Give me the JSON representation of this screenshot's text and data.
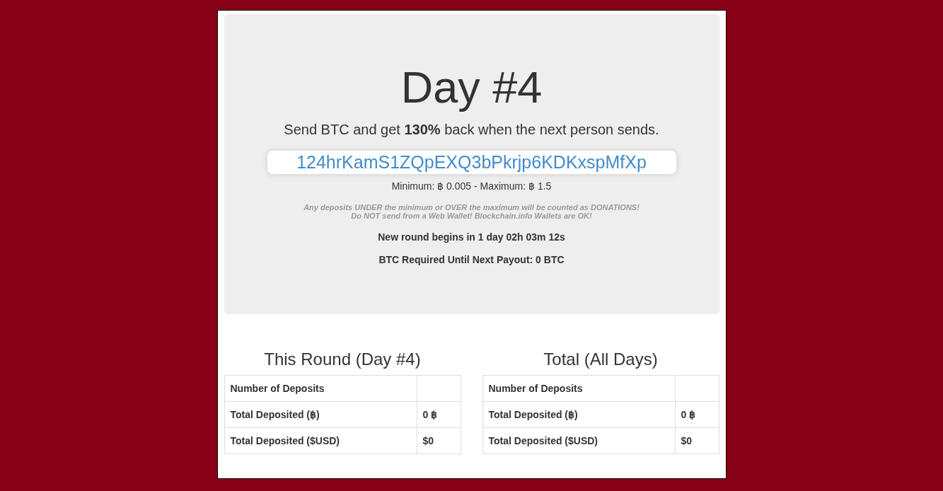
{
  "hero": {
    "title": "Day #4",
    "tagline": "Send BTC and get **130%** back when the next person sends.",
    "address": "124hrKamS1ZQpEXQ3bPkrjp6KDKxspMfXp",
    "limits": "Minimum: ฿ 0.005 - Maximum: ฿ 1.5",
    "warnings": [
      "Any deposits UNDER the minimum or OVER the maximum will be counted as DONATIONS!",
      "Do NOT send from a Web Wallet! Blockchain.info Wallets are OK!"
    ],
    "countdown": "New round begins in 1 day 02h 03m 12s",
    "required": "BTC Required Until Next Payout: 0 BTC"
  },
  "stats": [
    {
      "heading": "This Round (Day #4)",
      "rows": [
        {
          "label": "Number of Deposits"
        },
        {
          "label": "Total Deposited (฿)",
          "value": "0 ฿"
        },
        {
          "label": "Total Deposited ($USD)",
          "value": "$0"
        }
      ]
    },
    {
      "heading": "Total (All Days)",
      "rows": [
        {
          "label": "Number of Deposits"
        },
        {
          "label": "Total Deposited (฿)",
          "value": "0 ฿"
        },
        {
          "label": "Total Deposited ($USD)",
          "value": "$0"
        }
      ]
    }
  ]
}
